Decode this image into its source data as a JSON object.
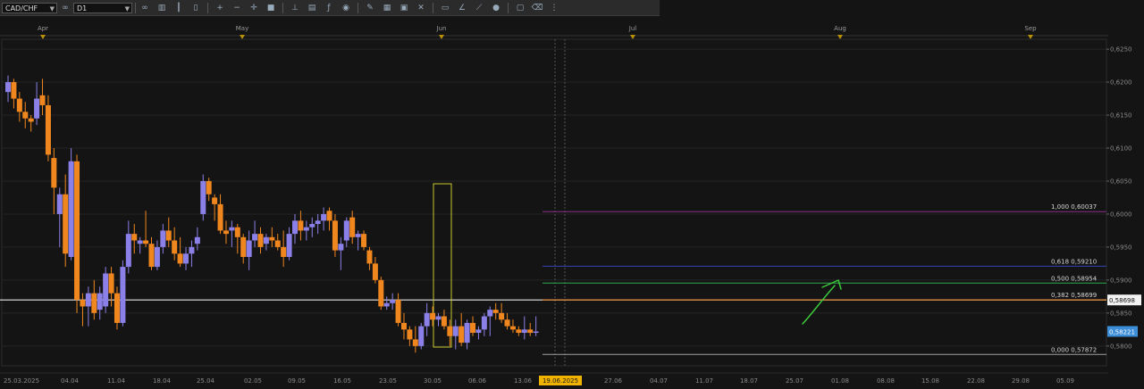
{
  "toolbar": {
    "symbol": "CAD/CHF",
    "timeframe": "D1",
    "buttons": [
      {
        "name": "link-icon",
        "glyph": "∞"
      },
      {
        "name": "chart-type-icon",
        "glyph": "▥"
      },
      {
        "name": "bars-icon",
        "glyph": "┃"
      },
      {
        "name": "candles-icon",
        "glyph": "▯"
      },
      {
        "name": "zoom-in-icon",
        "glyph": "+"
      },
      {
        "name": "zoom-out-icon",
        "glyph": "−"
      },
      {
        "name": "crosshair-icon",
        "glyph": "✛"
      },
      {
        "name": "stop-icon",
        "glyph": "■"
      },
      {
        "name": "line-tool-icon",
        "glyph": "⊥"
      },
      {
        "name": "template-icon",
        "glyph": "▤"
      },
      {
        "name": "indicator-icon",
        "glyph": "ƒ"
      },
      {
        "name": "globe-icon",
        "glyph": "◉"
      },
      {
        "name": "pencil-icon",
        "glyph": "✎"
      },
      {
        "name": "grid-icon",
        "glyph": "▦"
      },
      {
        "name": "calendar-icon",
        "glyph": "▣"
      },
      {
        "name": "cross-icon",
        "glyph": "✕"
      },
      {
        "name": "rectangle-icon",
        "glyph": "▭"
      },
      {
        "name": "angle-icon",
        "glyph": "∠"
      },
      {
        "name": "trend-icon",
        "glyph": "⟋"
      },
      {
        "name": "circle-icon",
        "glyph": "●"
      },
      {
        "name": "screen-icon",
        "glyph": "▢"
      },
      {
        "name": "eraser-icon",
        "glyph": "⌫"
      },
      {
        "name": "dots-icon",
        "glyph": "⋮"
      }
    ]
  },
  "colors": {
    "background": "#141414",
    "grid": "#242424",
    "bull": "#8b80e8",
    "bear": "#f0861e",
    "fib_100": "#8a2f8a",
    "fib_618": "#3245b5",
    "fib_500": "#2fa84a",
    "fib_382": "#f0861e",
    "fib_000": "#a0a0a0",
    "current_price_line": "#e6e6e6",
    "highlight_box": "#c8c832",
    "hand_arrow": "#3cc83c",
    "last_price_bg": "#3d8ed8",
    "date_highlight_bg": "#f0b400"
  },
  "chart_data": {
    "type": "candlestick",
    "symbol": "CAD/CHF",
    "timeframe": "D1",
    "ylim": [
      0.577,
      0.6265
    ],
    "y_ticks": [
      "0,6250",
      "0,6200",
      "0,6150",
      "0,6100",
      "0,6050",
      "0,6000",
      "0,5950",
      "0,5900",
      "0,5850",
      "0,5800"
    ],
    "x_date_labels": [
      "25.03.2025",
      "04.04",
      "11.04",
      "18.04",
      "25.04",
      "02.05",
      "09.05",
      "16.05",
      "23.05",
      "30.05",
      "06.06",
      "13.06",
      "19.06.2025",
      "27.06",
      "04.07",
      "11.07",
      "18.07",
      "25.07",
      "01.08",
      "08.08",
      "15.08",
      "22.08",
      "29.08",
      "05.09"
    ],
    "highlighted_date": "19.06.2025",
    "month_labels": [
      "Apr",
      "May",
      "Jun",
      "Jul",
      "Aug",
      "Sep"
    ],
    "price_labels": {
      "reference": "0,58698",
      "last": "0,58221"
    },
    "fibonacci": [
      {
        "level": "1,000",
        "price": "0,60037"
      },
      {
        "level": "0,618",
        "price": "0,59210"
      },
      {
        "level": "0,500",
        "price": "0,58954"
      },
      {
        "level": "0,382",
        "price": "0,58699"
      },
      {
        "level": "0,000",
        "price": "0,57872"
      }
    ],
    "candles": [
      [
        0.6185,
        0.621,
        0.617,
        0.62
      ],
      [
        0.62,
        0.6205,
        0.616,
        0.6175
      ],
      [
        0.6175,
        0.6185,
        0.614,
        0.6155
      ],
      [
        0.6155,
        0.617,
        0.613,
        0.6145
      ],
      [
        0.6145,
        0.615,
        0.6125,
        0.614
      ],
      [
        0.6145,
        0.62,
        0.6135,
        0.6175
      ],
      [
        0.618,
        0.6205,
        0.615,
        0.6165
      ],
      [
        0.6165,
        0.618,
        0.608,
        0.609
      ],
      [
        0.6085,
        0.61,
        0.6,
        0.604
      ],
      [
        0.6,
        0.604,
        0.595,
        0.603
      ],
      [
        0.603,
        0.606,
        0.592,
        0.594
      ],
      [
        0.5935,
        0.61,
        0.593,
        0.608
      ],
      [
        0.608,
        0.609,
        0.585,
        0.587
      ],
      [
        0.587,
        0.588,
        0.583,
        0.586
      ],
      [
        0.586,
        0.589,
        0.583,
        0.588
      ],
      [
        0.588,
        0.59,
        0.584,
        0.585
      ],
      [
        0.5855,
        0.589,
        0.584,
        0.588
      ],
      [
        0.586,
        0.592,
        0.585,
        0.591
      ],
      [
        0.591,
        0.592,
        0.586,
        0.588
      ],
      [
        0.588,
        0.589,
        0.5825,
        0.5835
      ],
      [
        0.5835,
        0.593,
        0.583,
        0.592
      ],
      [
        0.592,
        0.599,
        0.591,
        0.597
      ],
      [
        0.597,
        0.5985,
        0.594,
        0.596
      ],
      [
        0.5955,
        0.5965,
        0.594,
        0.596
      ],
      [
        0.596,
        0.6005,
        0.595,
        0.5955
      ],
      [
        0.5955,
        0.5965,
        0.5915,
        0.592
      ],
      [
        0.592,
        0.596,
        0.5915,
        0.595
      ],
      [
        0.595,
        0.5985,
        0.594,
        0.5975
      ],
      [
        0.5975,
        0.5995,
        0.595,
        0.596
      ],
      [
        0.596,
        0.598,
        0.593,
        0.594
      ],
      [
        0.594,
        0.5965,
        0.592,
        0.5925
      ],
      [
        0.5925,
        0.595,
        0.5915,
        0.594
      ],
      [
        0.594,
        0.596,
        0.592,
        0.595
      ],
      [
        0.5955,
        0.598,
        0.5945,
        0.5965
      ],
      [
        0.6,
        0.606,
        0.599,
        0.605
      ],
      [
        0.605,
        0.6055,
        0.602,
        0.603
      ],
      [
        0.6025,
        0.603,
        0.599,
        0.6015
      ],
      [
        0.6015,
        0.603,
        0.597,
        0.5975
      ],
      [
        0.5975,
        0.599,
        0.5955,
        0.597
      ],
      [
        0.5975,
        0.599,
        0.595,
        0.598
      ],
      [
        0.598,
        0.5985,
        0.594,
        0.5965
      ],
      [
        0.5965,
        0.597,
        0.5925,
        0.5935
      ],
      [
        0.5935,
        0.5975,
        0.5915,
        0.596
      ],
      [
        0.596,
        0.599,
        0.595,
        0.597
      ],
      [
        0.597,
        0.598,
        0.594,
        0.595
      ],
      [
        0.5955,
        0.597,
        0.5945,
        0.5965
      ],
      [
        0.5965,
        0.598,
        0.595,
        0.596
      ],
      [
        0.596,
        0.597,
        0.5945,
        0.595
      ],
      [
        0.595,
        0.5975,
        0.592,
        0.5935
      ],
      [
        0.5935,
        0.598,
        0.593,
        0.597
      ],
      [
        0.597,
        0.6,
        0.5955,
        0.599
      ],
      [
        0.599,
        0.6005,
        0.596,
        0.5975
      ],
      [
        0.5975,
        0.599,
        0.596,
        0.598
      ],
      [
        0.598,
        0.5995,
        0.5965,
        0.5985
      ],
      [
        0.5985,
        0.6,
        0.597,
        0.599
      ],
      [
        0.599,
        0.601,
        0.5975,
        0.6
      ],
      [
        0.6005,
        0.601,
        0.5975,
        0.599
      ],
      [
        0.599,
        0.6,
        0.5935,
        0.5945
      ],
      [
        0.5945,
        0.5965,
        0.5915,
        0.5955
      ],
      [
        0.596,
        0.5995,
        0.595,
        0.599
      ],
      [
        0.5995,
        0.6005,
        0.5955,
        0.5965
      ],
      [
        0.5965,
        0.5975,
        0.5945,
        0.597
      ],
      [
        0.597,
        0.5975,
        0.5945,
        0.595
      ],
      [
        0.5945,
        0.595,
        0.5915,
        0.5925
      ],
      [
        0.5925,
        0.5935,
        0.5895,
        0.59
      ],
      [
        0.59,
        0.5905,
        0.5855,
        0.586
      ],
      [
        0.586,
        0.5875,
        0.5855,
        0.5865
      ],
      [
        0.5865,
        0.588,
        0.5855,
        0.587
      ],
      [
        0.587,
        0.588,
        0.583,
        0.5835
      ],
      [
        0.5835,
        0.585,
        0.581,
        0.5825
      ],
      [
        0.5825,
        0.583,
        0.58,
        0.581
      ],
      [
        0.581,
        0.583,
        0.579,
        0.58
      ],
      [
        0.58,
        0.5835,
        0.5795,
        0.583
      ],
      [
        0.583,
        0.5865,
        0.5815,
        0.585
      ],
      [
        0.585,
        0.586,
        0.583,
        0.584
      ],
      [
        0.584,
        0.585,
        0.583,
        0.5845
      ],
      [
        0.5845,
        0.5855,
        0.5825,
        0.583
      ],
      [
        0.583,
        0.584,
        0.58,
        0.5815
      ],
      [
        0.5815,
        0.584,
        0.5795,
        0.583
      ],
      [
        0.583,
        0.585,
        0.58,
        0.5805
      ],
      [
        0.5805,
        0.584,
        0.5795,
        0.5835
      ],
      [
        0.5835,
        0.5845,
        0.5815,
        0.582
      ],
      [
        0.582,
        0.583,
        0.581,
        0.5825
      ],
      [
        0.5825,
        0.585,
        0.5815,
        0.5845
      ],
      [
        0.5845,
        0.586,
        0.5815,
        0.5855
      ],
      [
        0.5855,
        0.5865,
        0.584,
        0.585
      ],
      [
        0.585,
        0.5865,
        0.5835,
        0.584
      ],
      [
        0.584,
        0.585,
        0.5825,
        0.583
      ],
      [
        0.583,
        0.584,
        0.582,
        0.5825
      ],
      [
        0.5825,
        0.583,
        0.5815,
        0.582
      ],
      [
        0.582,
        0.5845,
        0.581,
        0.5825
      ],
      [
        0.5825,
        0.5835,
        0.5815,
        0.582
      ],
      [
        0.582,
        0.5845,
        0.5815,
        0.5822
      ]
    ]
  }
}
